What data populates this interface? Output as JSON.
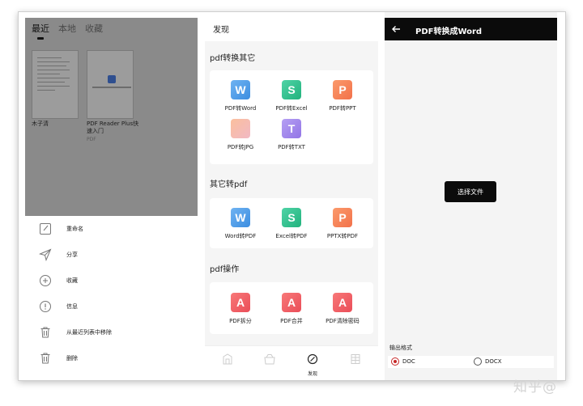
{
  "panel_recent": {
    "tabs": [
      "最近",
      "本地",
      "收藏"
    ],
    "active_tab": 0,
    "files": [
      {
        "name": "木子清",
        "sub": ""
      },
      {
        "name": "PDF Reader Plus快速入门",
        "sub": "PDF"
      }
    ],
    "menu": [
      {
        "label": "重命名",
        "icon": "rename-icon"
      },
      {
        "label": "分享",
        "icon": "share-icon"
      },
      {
        "label": "收藏",
        "icon": "favorite-icon"
      },
      {
        "label": "信息",
        "icon": "info-icon"
      },
      {
        "label": "从最近列表中移除",
        "icon": "remove-from-recent-icon"
      },
      {
        "label": "删除",
        "icon": "delete-icon"
      }
    ]
  },
  "panel_discover": {
    "title": "发现",
    "sections": [
      {
        "title": "pdf转换其它",
        "tools": [
          {
            "label": "PDF转Word",
            "glyph": "W",
            "color": "word"
          },
          {
            "label": "PDF转Excel",
            "glyph": "S",
            "color": "excel"
          },
          {
            "label": "PDF转PPT",
            "glyph": "P",
            "color": "ppt"
          },
          {
            "label": "PDF转JPG",
            "glyph": "",
            "color": "jpg"
          },
          {
            "label": "PDF转TXT",
            "glyph": "T",
            "color": "txt"
          }
        ]
      },
      {
        "title": "其它转pdf",
        "tools": [
          {
            "label": "Word转PDF",
            "glyph": "W",
            "color": "word"
          },
          {
            "label": "Excel转PDF",
            "glyph": "S",
            "color": "excel"
          },
          {
            "label": "PPTX转PDF",
            "glyph": "P",
            "color": "ppt"
          }
        ]
      },
      {
        "title": "pdf操作",
        "tools": [
          {
            "label": "PDF拆分",
            "glyph": "A",
            "color": "pdf"
          },
          {
            "label": "PDF合并",
            "glyph": "A",
            "color": "pdf"
          },
          {
            "label": "PDF清除密码",
            "glyph": "A",
            "color": "pdf"
          }
        ]
      }
    ],
    "bottom_nav": [
      {
        "label": "",
        "icon": "library-icon"
      },
      {
        "label": "",
        "icon": "store-icon"
      },
      {
        "label": "发现",
        "icon": "discover-icon",
        "active": true
      },
      {
        "label": "",
        "icon": "grid-icon"
      }
    ]
  },
  "panel_convert": {
    "title": "PDF转换成Word",
    "select_button": "选择文件",
    "output_label": "输出格式",
    "formats": [
      {
        "label": "DOC",
        "checked": true
      },
      {
        "label": "DOCX",
        "checked": false
      }
    ]
  },
  "watermark": "知乎@"
}
